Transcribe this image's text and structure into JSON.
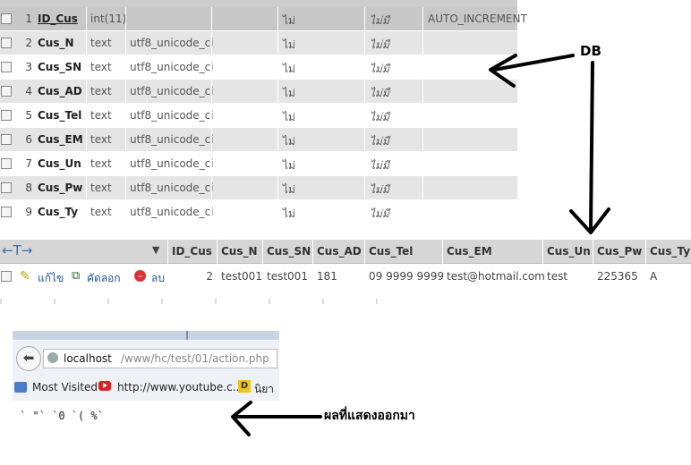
{
  "structure": {
    "rows": [
      {
        "num": "1",
        "name": "ID_Cus",
        "type": "int(11)",
        "collation": "",
        "null": "ไม่",
        "default": "ไม่มี",
        "extra": "AUTO_INCREMENT"
      },
      {
        "num": "2",
        "name": "Cus_N",
        "type": "text",
        "collation": "utf8_unicode_ci",
        "null": "ไม่",
        "default": "ไม่มี",
        "extra": ""
      },
      {
        "num": "3",
        "name": "Cus_SN",
        "type": "text",
        "collation": "utf8_unicode_ci",
        "null": "ไม่",
        "default": "ไม่มี",
        "extra": ""
      },
      {
        "num": "4",
        "name": "Cus_AD",
        "type": "text",
        "collation": "utf8_unicode_ci",
        "null": "ไม่",
        "default": "ไม่มี",
        "extra": ""
      },
      {
        "num": "5",
        "name": "Cus_Tel",
        "type": "text",
        "collation": "utf8_unicode_ci",
        "null": "ไม่",
        "default": "ไม่มี",
        "extra": ""
      },
      {
        "num": "6",
        "name": "Cus_EM",
        "type": "text",
        "collation": "utf8_unicode_ci",
        "null": "ไม่",
        "default": "ไม่มี",
        "extra": ""
      },
      {
        "num": "7",
        "name": "Cus_Un",
        "type": "text",
        "collation": "utf8_unicode_ci",
        "null": "ไม่",
        "default": "ไม่มี",
        "extra": ""
      },
      {
        "num": "8",
        "name": "Cus_Pw",
        "type": "text",
        "collation": "utf8_unicode_ci",
        "null": "ไม่",
        "default": "ไม่มี",
        "extra": ""
      },
      {
        "num": "9",
        "name": "Cus_Ty",
        "type": "text",
        "collation": "utf8_unicode_ci",
        "null": "ไม่",
        "default": "ไม่มี",
        "extra": ""
      }
    ]
  },
  "browse": {
    "columns": [
      "ID_Cus",
      "Cus_N",
      "Cus_SN",
      "Cus_AD",
      "Cus_Tel",
      "Cus_EM",
      "Cus_Un",
      "Cus_Pw",
      "Cus_Ty"
    ],
    "actions": {
      "edit": "แก้ไข",
      "copy": "คัดลอก",
      "delete": "ลบ"
    },
    "row": [
      "2",
      "test001",
      "test001",
      "181",
      "09 9999 9999",
      "test@hotmail.com",
      "test",
      "225365",
      "A"
    ]
  },
  "browser": {
    "url_host": "localhost",
    "url_path": "/www/hc/test/01/action.php",
    "bookmarks": {
      "most_visited": "Most Visited",
      "youtube": "http://www.youtube.c...",
      "third": "นิยา"
    }
  },
  "output_text": "` \"` `0 `( %`",
  "annotations": {
    "db": "DB",
    "result": "ผลที่แสดงออกมา"
  }
}
